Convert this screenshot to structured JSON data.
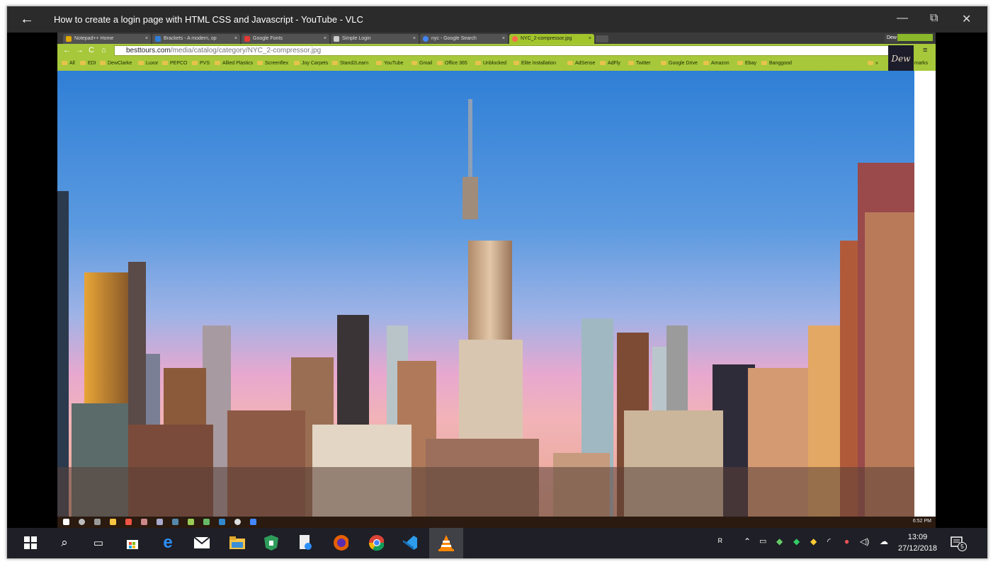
{
  "window": {
    "title": "How to create a login page with HTML CSS and Javascript - YouTube - VLC",
    "back_icon": "←",
    "minimize": "—",
    "restore": "⧉",
    "close": "✕"
  },
  "browser": {
    "tabs": [
      {
        "label": "Notepad++ Home",
        "icon_color": "#e1a800"
      },
      {
        "label": "Brackets - A modern, op",
        "icon_color": "#2f7ed8"
      },
      {
        "label": "Google Fonts",
        "icon_color": "#e53935"
      },
      {
        "label": "Simple Login",
        "icon_color": "#cccccc"
      },
      {
        "label": "nyc - Google Search",
        "icon_color": "#4285f4"
      },
      {
        "label": "NYC_2-compressor.jpg",
        "icon_color": "#ff6b4a",
        "active": true
      }
    ],
    "tab_close": "×",
    "user_chip": "Dew",
    "url_host": "besttours.com",
    "url_path": "/media/catalog/category/NYC_2-compressor.jpg",
    "bookmarks": [
      "All",
      "EDI",
      "DewClarke",
      "Luxor",
      "PEPCO",
      "PVS",
      "Allied Plastics",
      "Screenflex",
      "Joy Carpets",
      "Stand2Learn",
      "YouTube",
      "Gmail",
      "Office 365",
      "Unblocked",
      "Elite Installation",
      "AdSense",
      "AdFly",
      "Twitter",
      "Google Drive",
      "Amazon",
      "Ebay",
      "Banggood"
    ],
    "bookmarks_overflow": "»",
    "bookmarks_tail": "marks",
    "menu_icon": "≡",
    "logo_text": "Dew"
  },
  "inner_taskbar": {
    "time": "6:52 PM"
  },
  "taskbar": {
    "time": "13:09",
    "date": "27/12/2018",
    "notification_count": "5"
  }
}
